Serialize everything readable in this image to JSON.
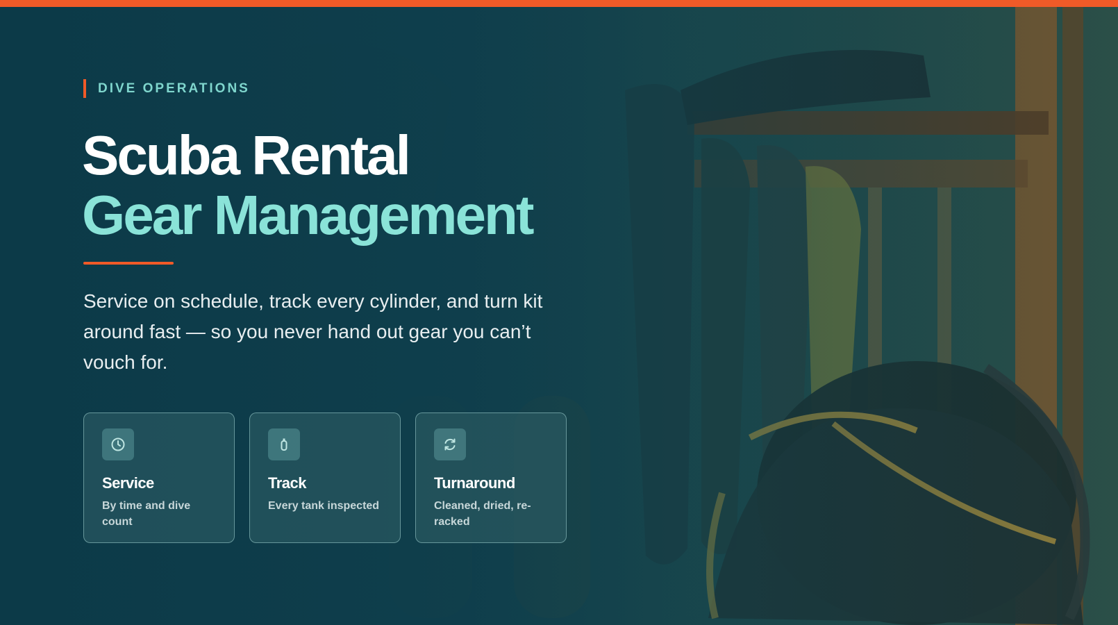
{
  "hero": {
    "eyebrow": "DIVE OPERATIONS",
    "title_line1": "Scuba Rental",
    "title_line2": "Gear Management",
    "lead": "Service on schedule, track every cylinder, and turn kit around fast — so you never hand out gear you can’t vouch for."
  },
  "cards": [
    {
      "icon": "clock-icon",
      "title": "Service",
      "desc": "By time and dive count"
    },
    {
      "icon": "tank-icon",
      "title": "Track",
      "desc": "Every tank inspected"
    },
    {
      "icon": "refresh-icon",
      "title": "Turnaround",
      "desc": "Cleaned, dried, re-racked"
    }
  ],
  "colors": {
    "accent": "#f05a28",
    "teal_text": "#8ae3d8",
    "eyebrow": "#7fd6cd",
    "background": "#0f3a46"
  }
}
